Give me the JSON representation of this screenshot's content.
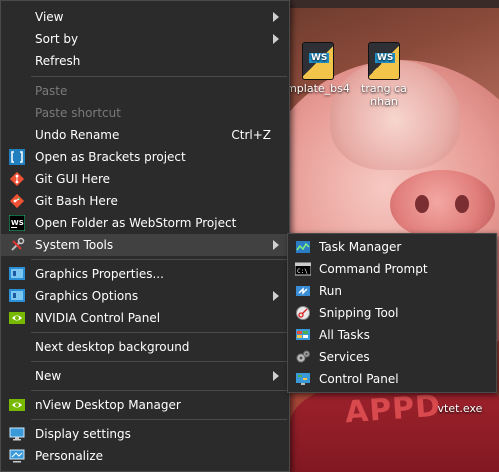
{
  "desktop": {
    "icons": [
      {
        "label": "mplate_bs4"
      },
      {
        "label": "trang ca nhan"
      },
      {
        "label": "vtet.exe"
      }
    ],
    "wallpaper_text": "APPD"
  },
  "context_menu": {
    "items": [
      {
        "label": "View",
        "submenu": true
      },
      {
        "label": "Sort by",
        "submenu": true
      },
      {
        "label": "Refresh"
      },
      {
        "label": "Paste",
        "disabled": true
      },
      {
        "label": "Paste shortcut",
        "disabled": true
      },
      {
        "label": "Undo Rename",
        "shortcut": "Ctrl+Z"
      },
      {
        "label": "Open as Brackets project",
        "icon": "brackets-icon"
      },
      {
        "label": "Git GUI Here",
        "icon": "git-gui-icon"
      },
      {
        "label": "Git Bash Here",
        "icon": "git-bash-icon"
      },
      {
        "label": "Open Folder as WebStorm Project",
        "icon": "webstorm-icon"
      },
      {
        "label": "System Tools",
        "icon": "tools-icon",
        "submenu": true,
        "highlighted": true
      },
      {
        "label": "Graphics Properties...",
        "icon": "intel-graphics-icon"
      },
      {
        "label": "Graphics Options",
        "icon": "intel-graphics-icon",
        "submenu": true
      },
      {
        "label": "NVIDIA Control Panel",
        "icon": "nvidia-icon"
      },
      {
        "label": "Next desktop background"
      },
      {
        "label": "New",
        "submenu": true
      },
      {
        "label": "nView Desktop Manager",
        "icon": "nvidia-icon"
      },
      {
        "label": "Display settings",
        "icon": "display-icon"
      },
      {
        "label": "Personalize",
        "icon": "personalize-icon"
      }
    ]
  },
  "system_tools_submenu": {
    "items": [
      {
        "label": "Task Manager",
        "icon": "task-manager-icon"
      },
      {
        "label": "Command Prompt",
        "icon": "command-prompt-icon"
      },
      {
        "label": "Run",
        "icon": "run-icon"
      },
      {
        "label": "Snipping Tool",
        "icon": "snipping-tool-icon"
      },
      {
        "label": "All Tasks",
        "icon": "all-tasks-icon"
      },
      {
        "label": "Services",
        "icon": "services-icon"
      },
      {
        "label": "Control Panel",
        "icon": "control-panel-icon"
      }
    ]
  },
  "colors": {
    "menu_bg": "#2b2b2b",
    "menu_highlight": "#414141",
    "disabled_text": "#7a7a7a"
  }
}
